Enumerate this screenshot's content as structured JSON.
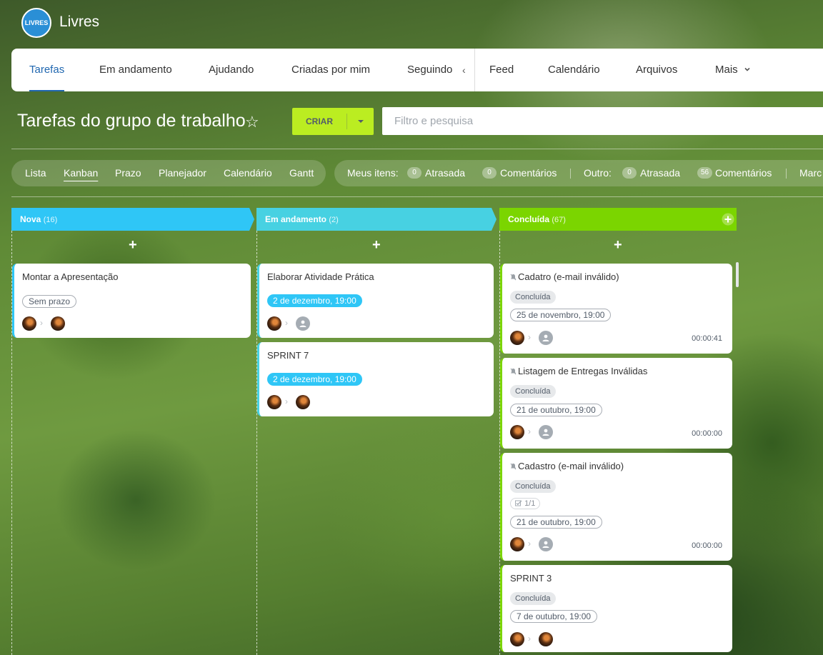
{
  "app": {
    "title": "Livres",
    "logo_text": "LIVRES"
  },
  "nav": {
    "items": [
      {
        "label": "Tarefas",
        "active": true
      },
      {
        "label": "Em andamento"
      },
      {
        "label": "Ajudando"
      },
      {
        "label": "Criadas por mim"
      },
      {
        "label": "Seguindo"
      },
      {
        "label": "Feed"
      },
      {
        "label": "Calendário"
      },
      {
        "label": "Arquivos"
      },
      {
        "label": "Mais"
      }
    ]
  },
  "page": {
    "title": "Tarefas do grupo de trabalho"
  },
  "toolbar": {
    "create_label": "CRIAR",
    "search_placeholder": "Filtro e pesquisa"
  },
  "views": [
    "Lista",
    "Kanban",
    "Prazo",
    "Planejador",
    "Calendário",
    "Gantt"
  ],
  "counters": {
    "mine_label": "Meus itens:",
    "mine_overdue_count": "0",
    "mine_overdue_label": "Atrasada",
    "mine_comments_count": "0",
    "mine_comments_label": "Comentários",
    "other_label": "Outro:",
    "other_overdue_count": "0",
    "other_overdue_label": "Atrasada",
    "other_comments_count": "56",
    "other_comments_label": "Comentários",
    "more_label": "Marc"
  },
  "columns": [
    {
      "title": "Nova",
      "count": "(16)",
      "color": "#2fc6f6"
    },
    {
      "title": "Em andamento",
      "count": "(2)",
      "color": "#47d1e2"
    },
    {
      "title": "Concluída",
      "count": "(67)",
      "color": "#7bd500"
    }
  ],
  "cards": {
    "c1": {
      "title": "Montar a Apresentação",
      "deadline": "Sem prazo"
    },
    "c2": {
      "title": "Elaborar Atividade Prática",
      "deadline": "2 de dezembro, 19:00"
    },
    "c3": {
      "title": "SPRINT 7",
      "deadline": "2 de dezembro, 19:00"
    },
    "c4": {
      "title": "Cadatro (e-mail inválido)",
      "status": "Concluída",
      "deadline": "25 de novembro, 19:00",
      "time": "00:00:41"
    },
    "c5": {
      "title": "Listagem de Entregas Inválidas",
      "status": "Concluída",
      "deadline": "21 de outubro, 19:00",
      "time": "00:00:00"
    },
    "c6": {
      "title": "Cadastro (e-mail inválido)",
      "status": "Concluída",
      "checklist": "1/1",
      "deadline": "21 de outubro, 19:00",
      "time": "00:00:00"
    },
    "c7": {
      "title": "SPRINT 3",
      "status": "Concluída",
      "deadline": "7 de outubro, 19:00"
    }
  },
  "colors": {
    "accent_blue": "#2067b0",
    "create_green": "#bbed21"
  }
}
